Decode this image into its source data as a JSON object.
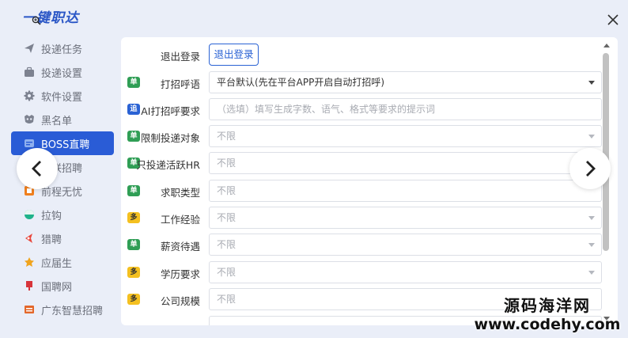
{
  "app": {
    "title": "一键职达",
    "close_icon": "close-icon"
  },
  "sidebar": {
    "items": [
      {
        "label": "投递任务",
        "icon": "send-icon",
        "active": false
      },
      {
        "label": "投递设置",
        "icon": "briefcase-icon",
        "active": false
      },
      {
        "label": "软件设置",
        "icon": "gear-icon",
        "active": false
      },
      {
        "label": "黑名单",
        "icon": "mask-icon",
        "active": false
      },
      {
        "label": "BOSS直聘",
        "icon": "boss-icon",
        "active": true
      },
      {
        "label": "智联招聘",
        "icon": "zhilian-icon",
        "active": false
      },
      {
        "label": "前程无忧",
        "icon": "51job-icon",
        "active": false
      },
      {
        "label": "拉钩",
        "icon": "lagou-icon",
        "active": false
      },
      {
        "label": "猎聘",
        "icon": "liepin-icon",
        "active": false
      },
      {
        "label": "应届生",
        "icon": "graduate-icon",
        "active": false
      },
      {
        "label": "国聘网",
        "icon": "guopin-icon",
        "active": false
      },
      {
        "label": "广东智慧招聘",
        "icon": "gd-icon",
        "active": false
      }
    ]
  },
  "form": {
    "logout": {
      "label": "退出登录",
      "button": "退出登录"
    },
    "rows": [
      {
        "badge": "单",
        "badge_color": "#2f9e55",
        "label": "打招呼语",
        "value": "平台默认(先在平台APP开启自动打招呼)",
        "type": "select"
      },
      {
        "badge": "追",
        "badge_color": "#2a62d4",
        "label": "AI打招呼要求",
        "placeholder": "（选填）填写生成字数、语气、格式等要求的提示词",
        "type": "input"
      },
      {
        "badge": "单",
        "badge_color": "#2f9e55",
        "label": "限制投递对象",
        "placeholder": "不限",
        "type": "select"
      },
      {
        "badge": "单",
        "badge_color": "#2f9e55",
        "label": "只投递活跃HR",
        "placeholder": "不限",
        "type": "select"
      },
      {
        "badge": "单",
        "badge_color": "#2f9e55",
        "label": "求职类型",
        "placeholder": "不限",
        "type": "select"
      },
      {
        "badge": "多",
        "badge_color": "#f4c020",
        "label": "工作经验",
        "placeholder": "不限",
        "type": "select"
      },
      {
        "badge": "单",
        "badge_color": "#2f9e55",
        "label": "薪资待遇",
        "placeholder": "不限",
        "type": "select"
      },
      {
        "badge": "多",
        "badge_color": "#f4c020",
        "label": "学历要求",
        "placeholder": "不限",
        "type": "select"
      },
      {
        "badge": "多",
        "badge_color": "#f4c020",
        "label": "公司规模",
        "placeholder": "不限",
        "type": "select"
      }
    ]
  },
  "watermark": {
    "line1": "源码海洋网",
    "line2": "www.codehy.com"
  }
}
